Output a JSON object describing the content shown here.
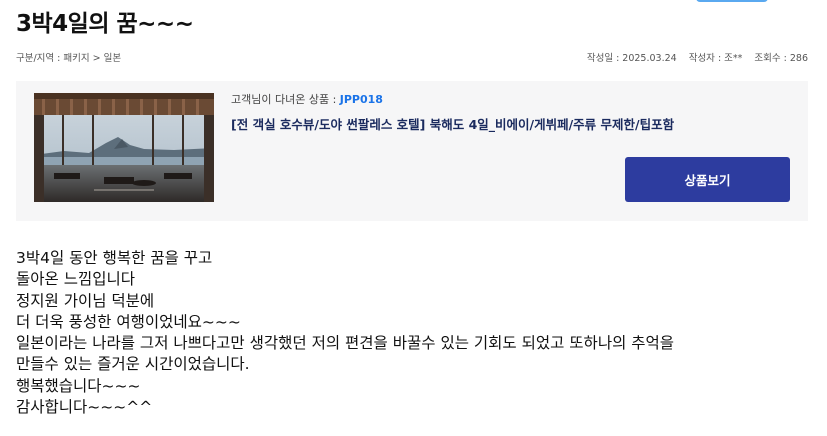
{
  "post": {
    "title": "3박4일의 꿈~~~",
    "breadcrumb": "구분/지역 : 패키지 > 일본",
    "date_label": "작성일 : 2025.03.24",
    "author_label": "작성자 : 조**",
    "views_label": "조회수 : 286"
  },
  "product": {
    "label": "고객님이 다녀온 상품 : ",
    "code": "JPP018",
    "name": "[전 객실 호수뷰/도야 썬팔레스 호텔] 북해도 4일_비에이/게뷔페/주류 무제한/팁포함",
    "button_label": "상품보기",
    "image_icon": "hotel-lobby-lake-photo"
  },
  "content": {
    "lines": [
      " 3박4일 동안 행복한 꿈을 꾸고",
      "돌아온 느낌입니다",
      "정지원 가이님 덕분에",
      "더 더욱 풍성한 여행이었네요~~~",
      "일본이라는 나라를 그저 나쁘다고만 생각했던 저의 편견을 바꿀수 있는 기회도 되었고 또하나의 추억을",
      "만들수 있는 즐거운 시간이었습니다.",
      "행복했습니다~~~",
      "감사합니다~~~^^"
    ]
  },
  "colors": {
    "button_bg": "#2d3c9f",
    "code_color": "#1a73e8",
    "product_box_bg": "#f6f6f7"
  }
}
